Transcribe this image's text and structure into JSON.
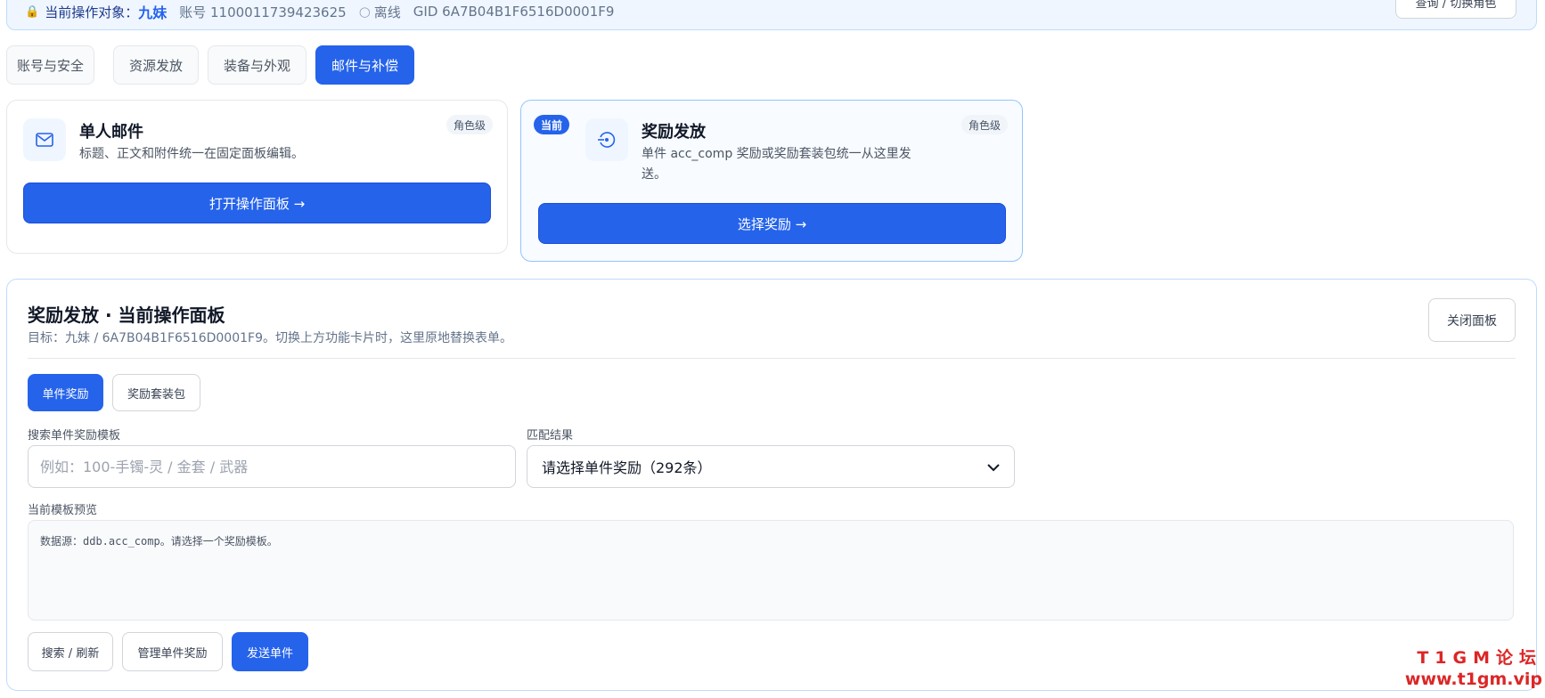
{
  "status": {
    "prefix": "当前操作对象：",
    "name": "九妹",
    "account": "账号 1100011739423625",
    "online": "离线",
    "gid": "GID 6A7B04B1F6516D0001F9",
    "switch_btn": "查询 / 切换角色"
  },
  "tabs": [
    {
      "label": "账号与安全"
    },
    {
      "label": "资源发放"
    },
    {
      "label": "装备与外观"
    },
    {
      "label": "邮件与补偿"
    }
  ],
  "cards": {
    "mail": {
      "title": "单人邮件",
      "desc": "标题、正文和附件统一在固定面板编辑。",
      "level": "角色级",
      "button": "打开操作面板 →"
    },
    "reward": {
      "current_badge": "当前",
      "title": "奖励发放",
      "desc": "单件 acc_comp 奖励或奖励套装包统一从这里发送。",
      "level": "角色级",
      "button": "选择奖励 →"
    }
  },
  "panel": {
    "title": "奖励发放 · 当前操作面板",
    "subtitle": "目标：九妹 / 6A7B04B1F6516D0001F9。切换上方功能卡片时，这里原地替换表单。",
    "close_btn": "关闭面板",
    "sub_tabs": [
      {
        "label": "单件奖励"
      },
      {
        "label": "奖励套装包"
      }
    ],
    "search_label": "搜索单件奖励模板",
    "search_value": "",
    "search_placeholder": "例如：100-手镯-灵 / 金套 / 武器",
    "match_label": "匹配结果",
    "match_selected": "请选择单件奖励（292条）",
    "preview_label": "当前模板预览",
    "preview_text": "数据源：ddb.acc_comp。请选择一个奖励模板。",
    "actions": [
      {
        "label": "搜索 / 刷新"
      },
      {
        "label": "管理单件奖励"
      },
      {
        "label": "发送单件"
      }
    ]
  },
  "watermark": {
    "line1": "T1GM论坛",
    "line2": "www.t1gm.vip"
  },
  "colors": {
    "primary": "#2563eb",
    "panel_border": "#bfdbfe",
    "watermark": "#dc2626"
  }
}
